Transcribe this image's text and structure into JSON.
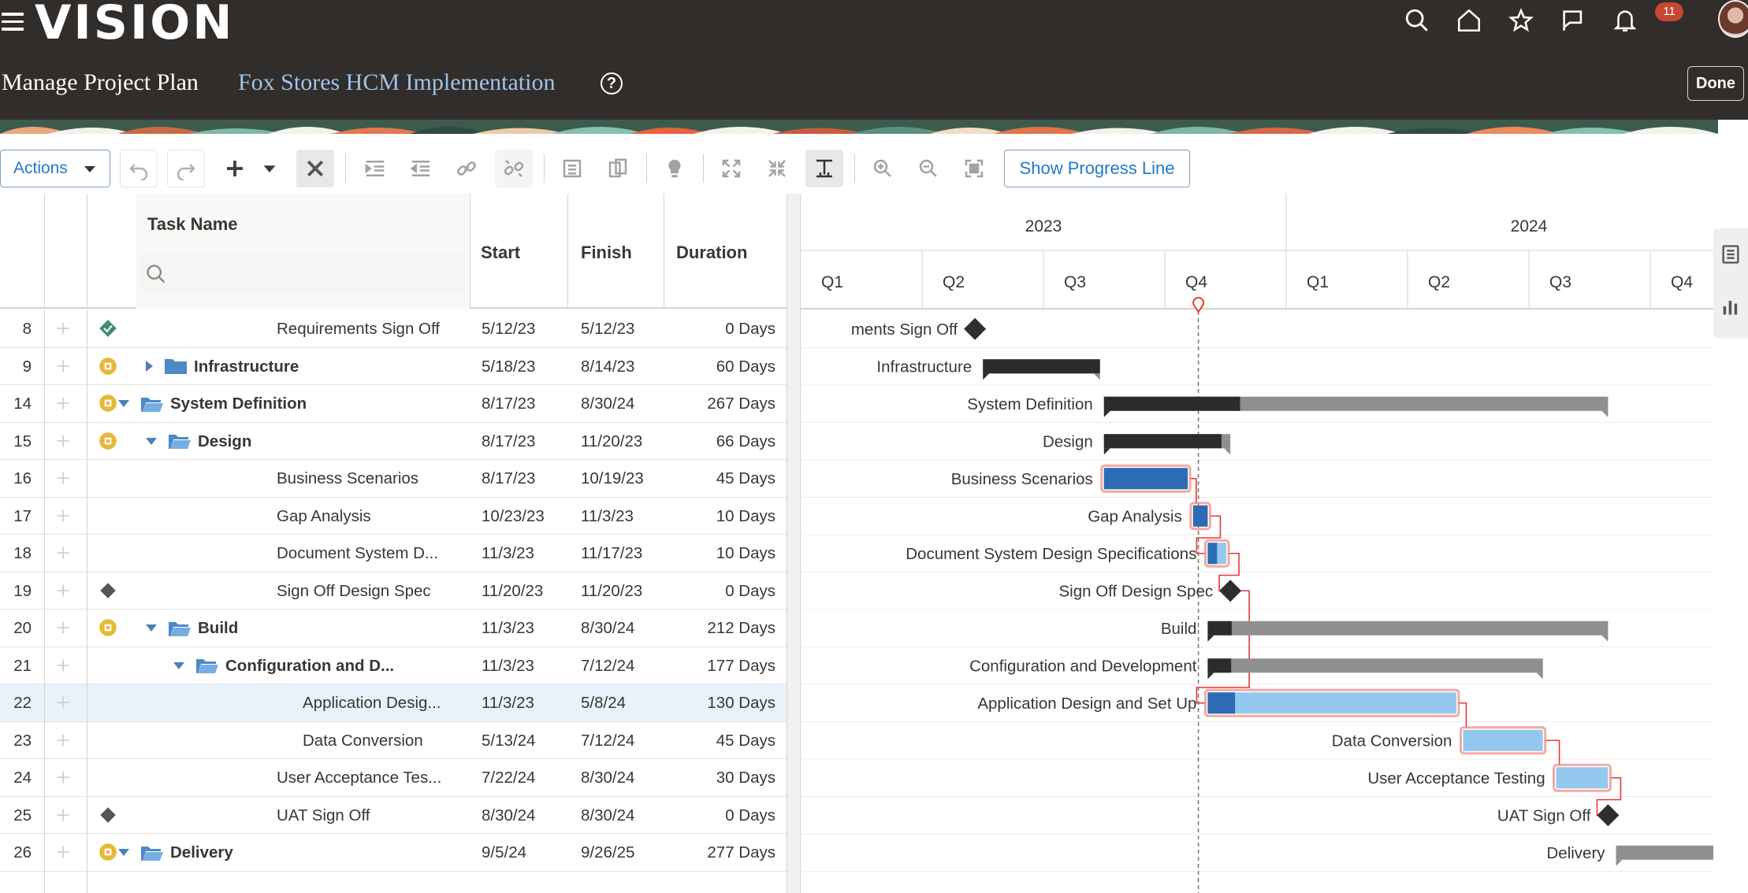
{
  "header": {
    "logo": "VISION",
    "page_title": "Manage Project Plan",
    "project_name": "Fox Stores HCM Implementation",
    "help": "?",
    "done_label": "Done",
    "notifications_count": "11",
    "icons": [
      "search-icon",
      "home-icon",
      "star-icon",
      "flag-icon",
      "bell-icon"
    ]
  },
  "toolbar": {
    "actions_label": "Actions",
    "show_progress_label": "Show Progress Line",
    "icons": [
      "undo-icon",
      "redo-icon",
      "add-icon",
      "add-menu-caret-icon",
      "delete-icon",
      "indent-icon",
      "outdent-icon",
      "link-icon",
      "unlink-icon",
      "details-icon",
      "paste-icon",
      "lightbulb-icon",
      "expand-icon",
      "collapse-icon",
      "critical-path-icon",
      "zoom-in-icon",
      "zoom-out-icon",
      "fit-icon"
    ]
  },
  "grid": {
    "columns": {
      "task_name": "Task Name",
      "start": "Start",
      "finish": "Finish",
      "duration": "Duration"
    },
    "search_placeholder": "",
    "rows": [
      {
        "id": "8",
        "name": "Requirements Sign Off",
        "start": "5/12/23",
        "finish": "5/12/23",
        "duration": "0 Days",
        "level": 3,
        "indicator": "milestone-complete",
        "summary": false
      },
      {
        "id": "9",
        "name": "Infrastructure",
        "start": "5/18/23",
        "finish": "8/14/23",
        "duration": "60 Days",
        "level": 1,
        "indicator": "summary",
        "summary": true,
        "expanded": false
      },
      {
        "id": "14",
        "name": "System Definition",
        "start": "8/17/23",
        "finish": "8/30/24",
        "duration": "267 Days",
        "level": 0,
        "indicator": "summary",
        "summary": true,
        "expanded": true
      },
      {
        "id": "15",
        "name": "Design",
        "start": "8/17/23",
        "finish": "11/20/23",
        "duration": "66 Days",
        "level": 1,
        "indicator": "summary",
        "summary": true,
        "expanded": true
      },
      {
        "id": "16",
        "name": "Business Scenarios",
        "start": "8/17/23",
        "finish": "10/19/23",
        "duration": "45 Days",
        "level": 3,
        "indicator": "",
        "summary": false
      },
      {
        "id": "17",
        "name": "Gap Analysis",
        "start": "10/23/23",
        "finish": "11/3/23",
        "duration": "10 Days",
        "level": 3,
        "indicator": "",
        "summary": false
      },
      {
        "id": "18",
        "name": "Document System D...",
        "start": "11/3/23",
        "finish": "11/17/23",
        "duration": "10 Days",
        "level": 3,
        "indicator": "",
        "summary": false
      },
      {
        "id": "19",
        "name": "Sign Off Design Spec",
        "start": "11/20/23",
        "finish": "11/20/23",
        "duration": "0 Days",
        "level": 3,
        "indicator": "milestone",
        "summary": false
      },
      {
        "id": "20",
        "name": "Build",
        "start": "11/3/23",
        "finish": "8/30/24",
        "duration": "212 Days",
        "level": 1,
        "indicator": "summary",
        "summary": true,
        "expanded": true
      },
      {
        "id": "21",
        "name": "Configuration and D...",
        "start": "11/3/23",
        "finish": "7/12/24",
        "duration": "177 Days",
        "level": 2,
        "indicator": "",
        "summary": true,
        "expanded": true
      },
      {
        "id": "22",
        "name": "Application Desig...",
        "start": "11/3/23",
        "finish": "5/8/24",
        "duration": "130 Days",
        "level": 4,
        "indicator": "",
        "summary": false,
        "selected": true
      },
      {
        "id": "23",
        "name": "Data Conversion",
        "start": "5/13/24",
        "finish": "7/12/24",
        "duration": "45 Days",
        "level": 4,
        "indicator": "",
        "summary": false
      },
      {
        "id": "24",
        "name": "User Acceptance Tes...",
        "start": "7/22/24",
        "finish": "8/30/24",
        "duration": "30 Days",
        "level": 3,
        "indicator": "",
        "summary": false
      },
      {
        "id": "25",
        "name": "UAT Sign Off",
        "start": "8/30/24",
        "finish": "8/30/24",
        "duration": "0 Days",
        "level": 3,
        "indicator": "milestone",
        "summary": false
      },
      {
        "id": "26",
        "name": "Delivery",
        "start": "9/5/24",
        "finish": "9/26/25",
        "duration": "277 Days",
        "level": 0,
        "indicator": "summary",
        "summary": true,
        "expanded": true
      }
    ]
  },
  "gantt": {
    "years": [
      "2023",
      "2024"
    ],
    "quarters": [
      "Q1",
      "Q2",
      "Q3",
      "Q4",
      "Q1",
      "Q2",
      "Q3",
      "Q4"
    ],
    "bars": [
      {
        "label": "ments Sign Off",
        "type": "milestone",
        "start": "2023-05-12",
        "finish": "2023-05-12"
      },
      {
        "label": "Infrastructure",
        "type": "summary",
        "start": "2023-05-18",
        "finish": "2023-08-14",
        "percent_complete": 100
      },
      {
        "label": "System Definition",
        "type": "summary",
        "start": "2023-08-17",
        "finish": "2024-08-30",
        "percent_complete": 27
      },
      {
        "label": "Design",
        "type": "summary",
        "start": "2023-08-17",
        "finish": "2023-11-20",
        "percent_complete": 93
      },
      {
        "label": "Business Scenarios",
        "type": "critical",
        "start": "2023-08-17",
        "finish": "2023-10-19",
        "percent_complete": 100
      },
      {
        "label": "Gap Analysis",
        "type": "critical",
        "start": "2023-10-23",
        "finish": "2023-11-03",
        "percent_complete": 100
      },
      {
        "label": "Document System Design Specifications",
        "type": "critical",
        "start": "2023-11-03",
        "finish": "2023-11-17",
        "percent_complete": 50
      },
      {
        "label": "Sign Off Design Spec",
        "type": "milestone",
        "start": "2023-11-20",
        "finish": "2023-11-20"
      },
      {
        "label": "Build",
        "type": "summary",
        "start": "2023-11-03",
        "finish": "2024-08-30",
        "percent_complete": 6
      },
      {
        "label": "Configuration and Development",
        "type": "summary",
        "start": "2023-11-03",
        "finish": "2024-07-12",
        "percent_complete": 7
      },
      {
        "label": "Application Design and Set Up",
        "type": "critical",
        "start": "2023-11-03",
        "finish": "2024-05-08",
        "percent_complete": 11
      },
      {
        "label": "Data Conversion",
        "type": "critical",
        "start": "2024-05-13",
        "finish": "2024-07-12",
        "percent_complete": 0
      },
      {
        "label": "User Acceptance Testing",
        "type": "critical",
        "start": "2024-07-22",
        "finish": "2024-08-30",
        "percent_complete": 0
      },
      {
        "label": "UAT Sign Off",
        "type": "milestone",
        "start": "2024-08-30",
        "finish": "2024-08-30"
      },
      {
        "label": "Delivery",
        "type": "summary",
        "start": "2024-09-05",
        "finish": "2025-09-26",
        "percent_complete": 0
      }
    ],
    "colors": {
      "critical_glow": "#f1948a",
      "progress": "#2d6cb5",
      "remaining": "#95c8ee",
      "summary_done": "#2b2b2b",
      "summary_left": "#8f8f8f",
      "link": "#e53935",
      "today": "#e53935"
    }
  },
  "side_panel": {
    "icons": [
      "table-view-icon",
      "chart-view-icon"
    ]
  }
}
